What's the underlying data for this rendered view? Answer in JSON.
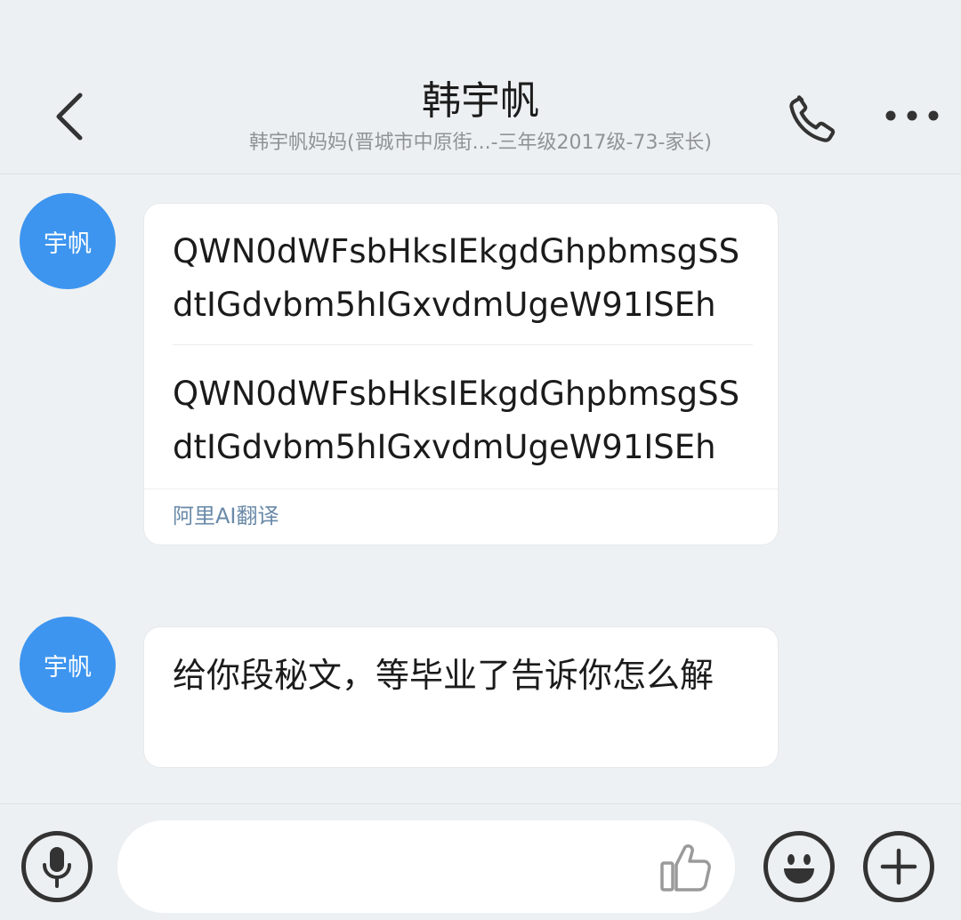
{
  "header": {
    "title": "韩宇帆",
    "subtitle": "韩宇帆妈妈(晋城市中原街...-三年级2017级-73-家长)",
    "back_icon": "chevron-left-icon",
    "call_icon": "phone-icon",
    "more_icon": "more-horizontal-icon"
  },
  "messages": [
    {
      "avatar_label": "宇帆",
      "text": "QWN0dWFsbHksIEkgdGhpbmsgSSdtIGdvbm5hIGxvdmUgeW91ISEh",
      "translation": "QWN0dWFsbHksIEkgdGhpbmsgSSdtIGdvbm5hIGxvdmUgeW91ISEh",
      "translation_label": "阿里AI翻译"
    },
    {
      "avatar_label": "宇帆",
      "text": "给你段秘文，等毕业了告诉你怎么解"
    }
  ],
  "input_bar": {
    "placeholder": "",
    "voice_icon": "microphone-icon",
    "like_icon": "thumbs-up-icon",
    "emoji_icon": "smiley-icon",
    "plus_icon": "plus-icon"
  },
  "colors": {
    "accent": "#3d95ef",
    "background": "#eef1f3",
    "bubble": "#ffffff",
    "translate_link": "#6a8aa8"
  }
}
